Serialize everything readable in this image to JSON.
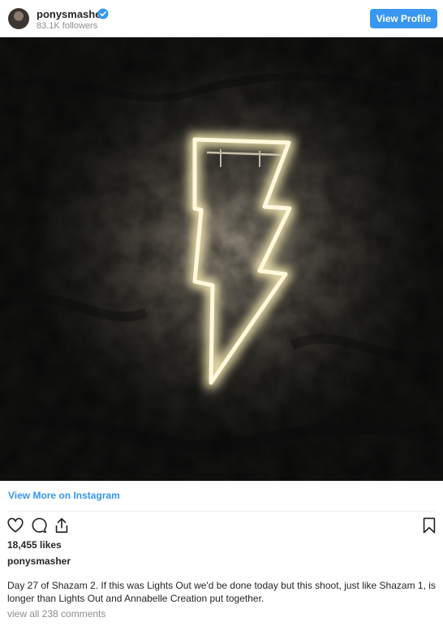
{
  "header": {
    "username": "ponysmasher",
    "followers": "83.1K followers",
    "view_profile_label": "View Profile",
    "verified_icon": "verified-badge-icon"
  },
  "post": {
    "image_subject": "neon lightning bolt sign on dark rock wall",
    "view_more_label": "View More on Instagram",
    "actions": [
      "heart-icon",
      "comment-icon",
      "share-icon",
      "bookmark-icon"
    ],
    "likes": "18,455 likes",
    "author": "ponysmasher",
    "caption": "Day 27 of Shazam 2. If this was Lights Out we'd be done today but this shoot, just like Shazam 1, is longer than Lights Out and Annabelle Creation put together.",
    "comments_label": "view all 238 comments"
  },
  "colors": {
    "accent": "#3897f0",
    "text": "#262626",
    "muted": "#8e8e8e",
    "neon": "#fff6d8"
  }
}
